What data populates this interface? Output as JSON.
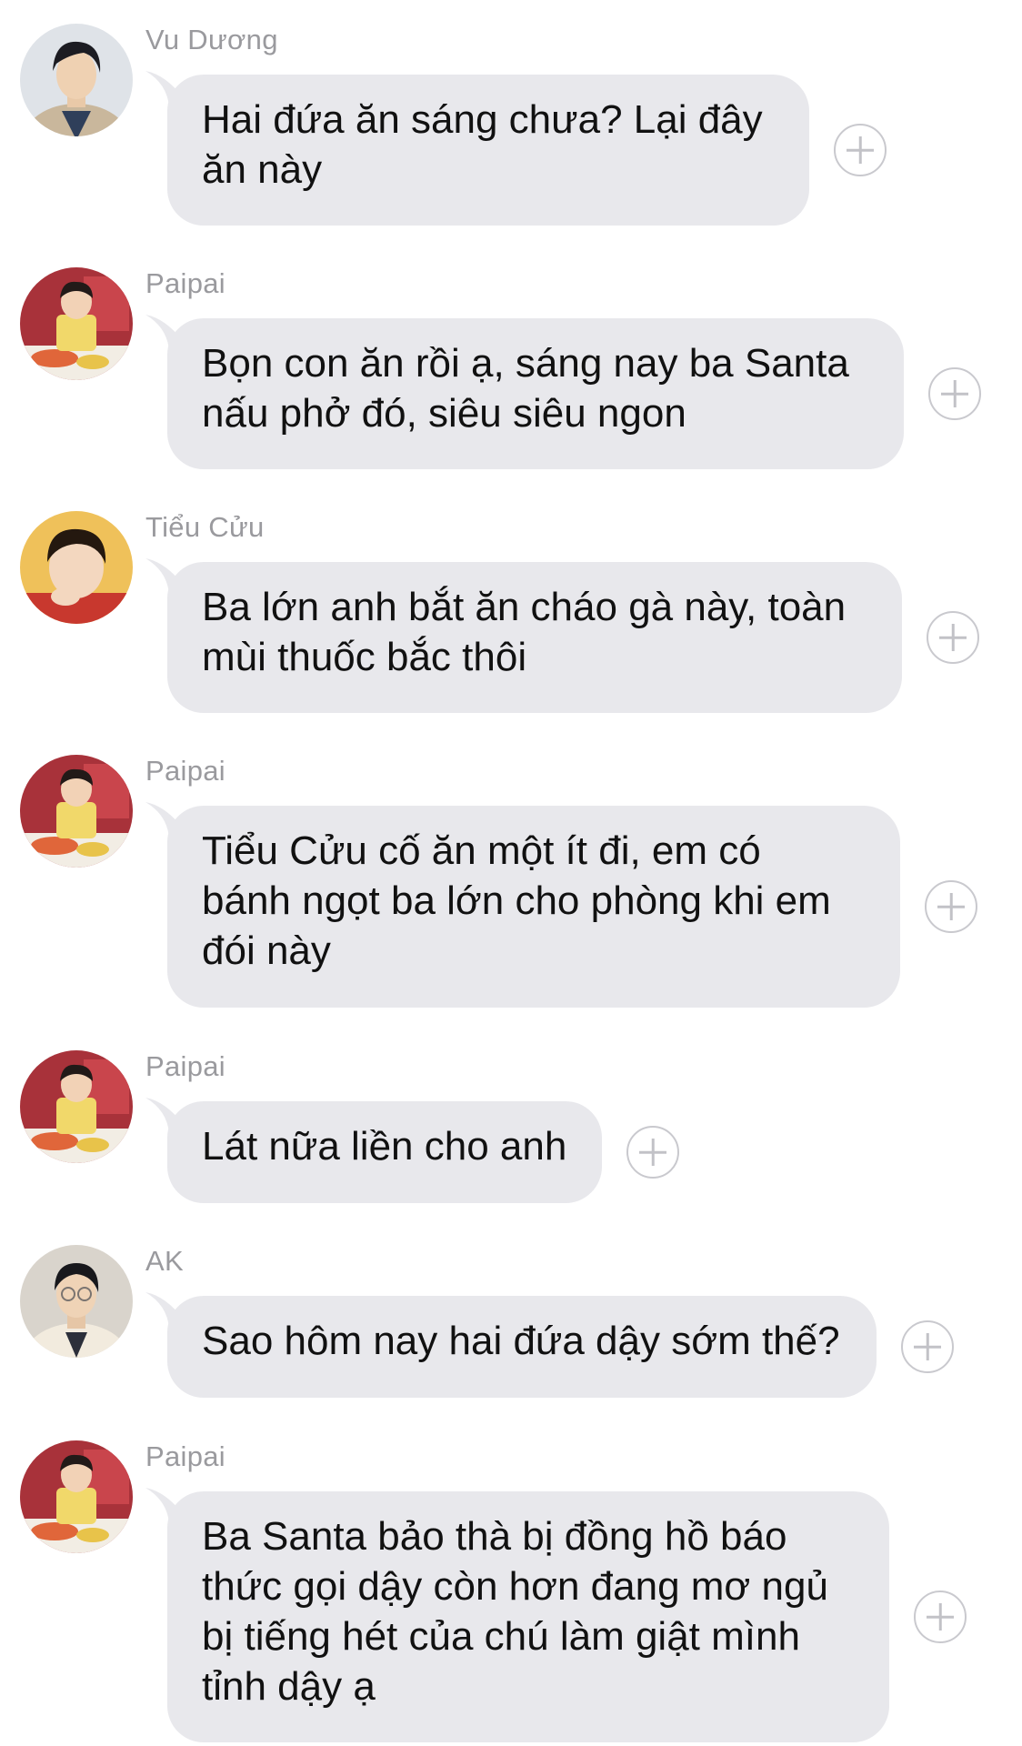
{
  "messages": [
    {
      "sender": "Vu Dương",
      "avatar": "male-portrait-avatar",
      "text": "Hai đứa ăn sáng chưa? Lại đây\năn này"
    },
    {
      "sender": "Paipai",
      "avatar": "child-painting-avatar",
      "text": "Bọn con ăn rồi ạ, sáng nay ba Santa\nnấu phở đó, siêu siêu ngon"
    },
    {
      "sender": "Tiểu Cửu",
      "avatar": "child-thinking-avatar",
      "text": "Ba lớn anh bắt ăn cháo gà này, toàn\nmùi thuốc bắc thôi"
    },
    {
      "sender": "Paipai",
      "avatar": "child-painting-avatar",
      "text": "Tiểu Cửu cố ăn một ít đi, em có\nbánh ngọt ba lớn cho phòng khi em\nđói này"
    },
    {
      "sender": "Paipai",
      "avatar": "child-painting-avatar",
      "text": "Lát nữa liền cho anh"
    },
    {
      "sender": "AK",
      "avatar": "male-glasses-avatar",
      "text": "Sao hôm nay hai đứa dậy sớm thế?"
    },
    {
      "sender": "Paipai",
      "avatar": "child-painting-avatar",
      "text": "Ba Santa bảo thà bị đồng hồ báo\nthức gọi dậy còn hơn đang mơ ngủ\nbị tiếng hét của chú làm giật mình\ntỉnh dậy ạ"
    }
  ],
  "colors": {
    "bubble": "#e8e8ec",
    "sender": "#9a9a9e",
    "text": "#111111",
    "react_button": "#c9c9ce"
  },
  "icons": {
    "reaction": "add-reaction-icon"
  }
}
